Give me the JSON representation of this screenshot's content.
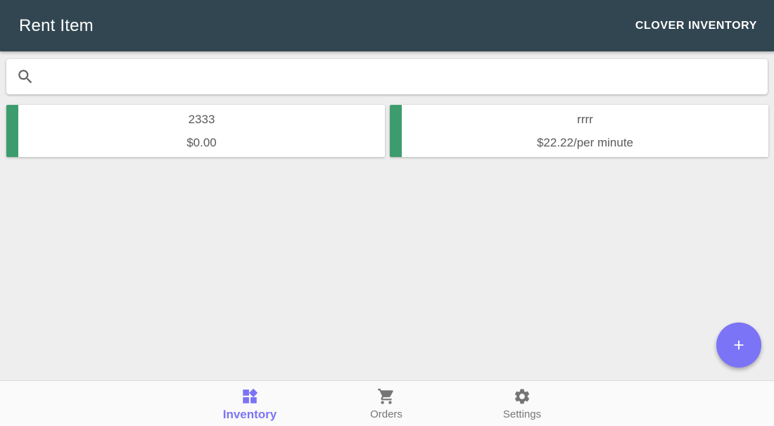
{
  "toolbar": {
    "title": "Rent Item",
    "action_label": "CLOVER INVENTORY"
  },
  "search": {
    "value": "",
    "placeholder": "",
    "icon": "search-icon"
  },
  "items": [
    {
      "name": "2333",
      "price": "$0.00",
      "accent_color": "#3d9c6e"
    },
    {
      "name": "rrrr",
      "price": "$22.22/per minute",
      "accent_color": "#3d9c6e"
    }
  ],
  "fab": {
    "icon": "plus-icon"
  },
  "bottom_nav": {
    "items": [
      {
        "label": "Inventory",
        "icon": "dashboard-icon",
        "active": true
      },
      {
        "label": "Orders",
        "icon": "shopping-cart-icon",
        "active": false
      },
      {
        "label": "Settings",
        "icon": "gear-icon",
        "active": false
      }
    ]
  },
  "colors": {
    "toolbar_bg": "#324651",
    "accent": "#7b74f6",
    "item_stripe": "#3d9c6e",
    "inactive_nav": "#777777",
    "background": "#eeeeee"
  }
}
